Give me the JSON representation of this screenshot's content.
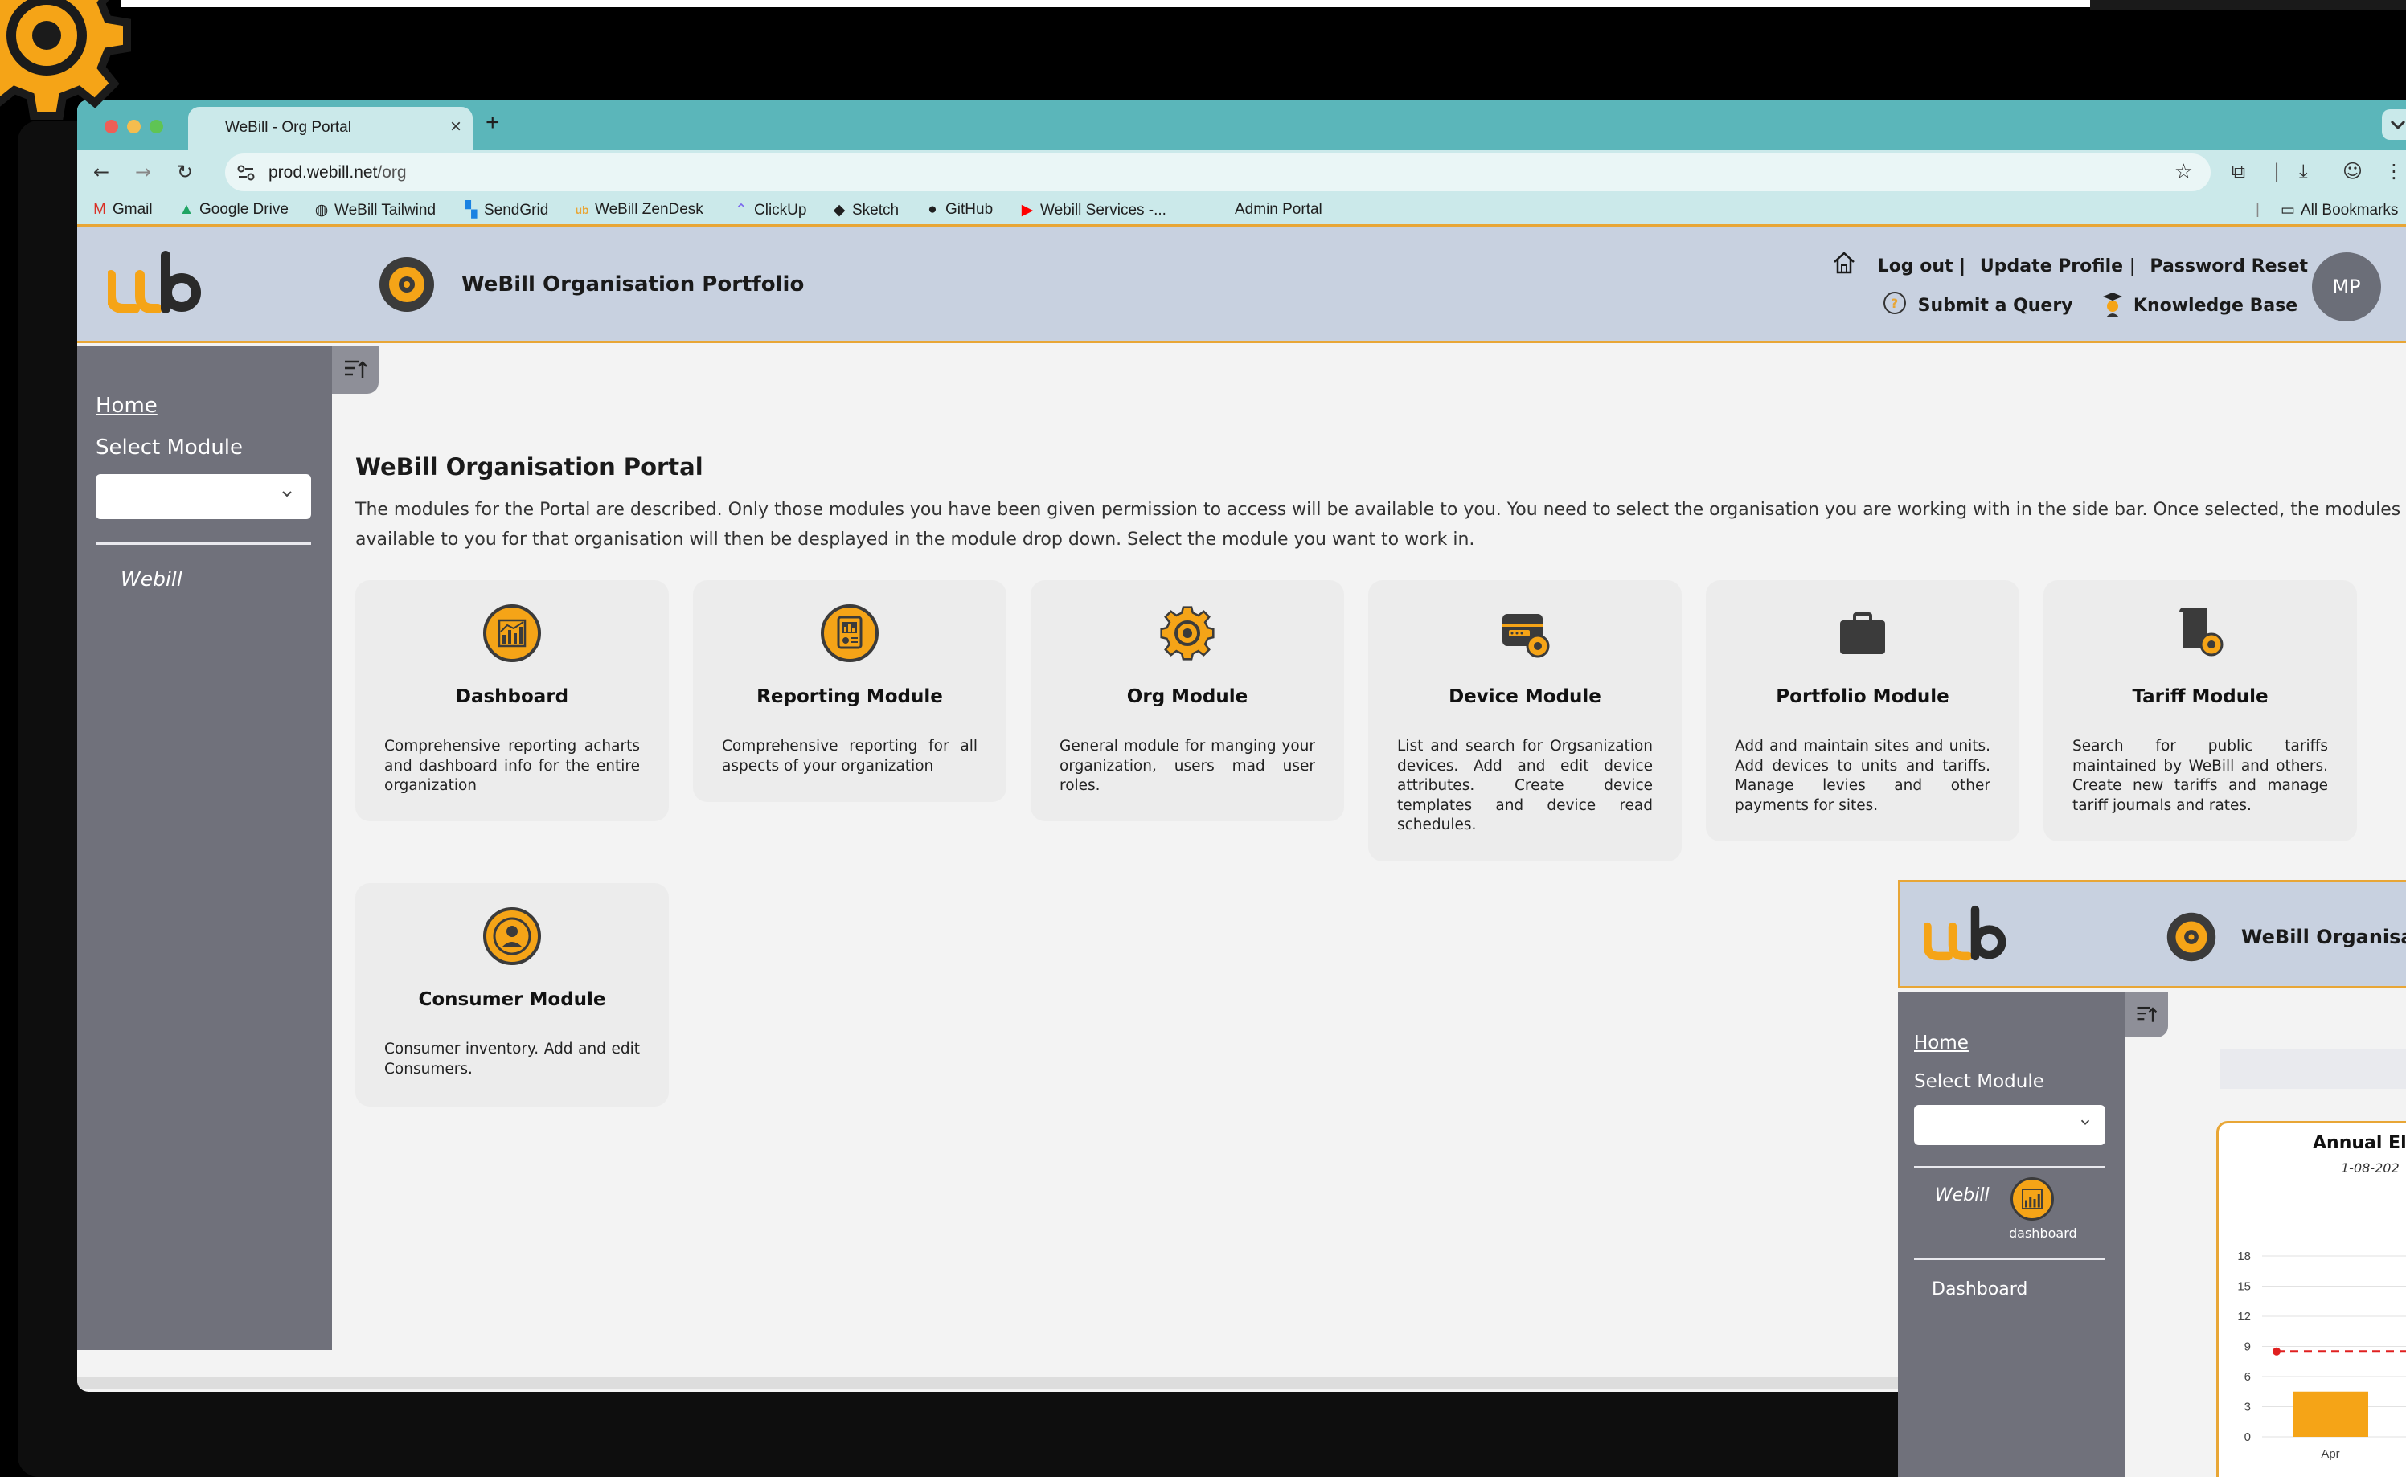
{
  "browser": {
    "tab_title": "WeBill - Org Portal",
    "tab_close": "×",
    "new_tab": "+",
    "url_host": "prod.webill.net",
    "url_path": "/org",
    "bookmarks": [
      {
        "label": "Gmail",
        "icon": "gmail-icon"
      },
      {
        "label": "Google Drive",
        "icon": "google-drive-icon"
      },
      {
        "label": "WeBill Tailwind",
        "icon": "globe-icon"
      },
      {
        "label": "SendGrid",
        "icon": "sendgrid-icon"
      },
      {
        "label": "WeBill ZenDesk",
        "icon": "webill-icon"
      },
      {
        "label": "ClickUp",
        "icon": "clickup-icon"
      },
      {
        "label": "Sketch",
        "icon": "sketch-icon"
      },
      {
        "label": "GitHub",
        "icon": "github-icon"
      },
      {
        "label": "Webill Services -...",
        "icon": "youtube-icon"
      },
      {
        "label": "Admin Portal",
        "icon": ""
      }
    ],
    "all_bookmarks": "All Bookmarks"
  },
  "header": {
    "title": "WeBill Organisation Portfolio",
    "logout": "Log out |",
    "update_profile": "Update Profile |",
    "password_reset": "Password Reset",
    "submit_query": "Submit a Query",
    "knowledge_base": "Knowledge Base",
    "avatar_initials": "MP"
  },
  "sidebar": {
    "home": "Home",
    "select_module_label": "Select Module",
    "select_value": "",
    "org_item": "Webill"
  },
  "main": {
    "title": "WeBill Organisation Portal",
    "description": "The modules for the Portal are described. Only those modules you have been given permission to access will be available to you. You need to select the organisation you are working with in the side bar. Once selected, the modules available to you for that organisation will then be desplayed in the module drop down. Select the module you want to work in.",
    "modules": [
      {
        "title": "Dashboard",
        "icon": "dashboard-chart-icon",
        "desc": "Comprehensive reporting acharts and dashboard info for the entire organization"
      },
      {
        "title": "Reporting Module",
        "icon": "report-icon",
        "desc": "Comprehensive reporting for all aspects of your organization"
      },
      {
        "title": "Org Module",
        "icon": "gear-icon",
        "desc": "General module for manging your organization, users mad user roles."
      },
      {
        "title": "Device Module",
        "icon": "device-settings-icon",
        "desc": "List and search for Orgsanization devices. Add and edit device attributes. Create device templates and device read schedules."
      },
      {
        "title": "Portfolio Module",
        "icon": "briefcase-icon",
        "desc": "Add and maintain sites and units. Add devices to units and tariffs. Manage levies and other payments for sites."
      },
      {
        "title": "Tariff Module",
        "icon": "tariff-settings-icon",
        "desc": "Search for public tariffs maintained by WeBill and others. Create new tariffs and manage tariff journals and rates."
      },
      {
        "title": "Consumer Module",
        "icon": "user-circle-icon",
        "desc": "Consumer inventory. Add and edit Consumers."
      }
    ]
  },
  "preview": {
    "header_title": "WeBill Organisati",
    "home": "Home",
    "select_module_label": "Select Module",
    "org_item": "Webill",
    "dashboard_badge": "dashboard",
    "menu_dashboard": "Dashboard",
    "chart_title": "Annual El",
    "chart_subtitle": "1-08-202"
  },
  "chart_data": {
    "type": "bar",
    "title": "Annual El",
    "subtitle": "1-08-202",
    "categories": [
      "Apr"
    ],
    "values": [
      4.5
    ],
    "yticks": [
      0,
      3,
      6,
      9,
      12,
      15,
      18
    ],
    "ylim": [
      0,
      18
    ],
    "threshold": 8.5,
    "colors": {
      "bar": "#f5a417",
      "threshold": "#e02020"
    }
  },
  "colors": {
    "accent": "#e8a636",
    "header_bg": "#c8d1e0",
    "sidebar_bg": "#70717b",
    "chrome_tab": "#5bb6ba"
  }
}
